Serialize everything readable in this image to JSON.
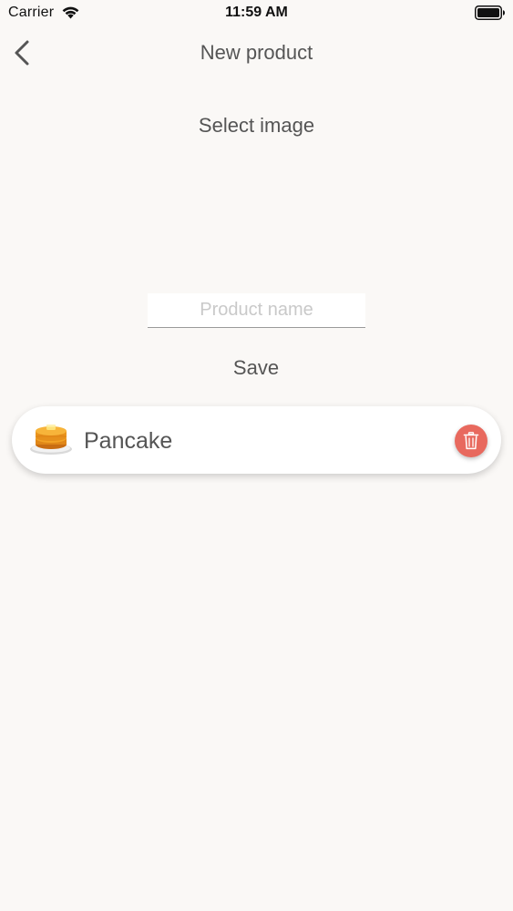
{
  "status_bar": {
    "carrier": "Carrier",
    "time": "11:59 AM",
    "wifi_icon": "wifi-icon",
    "battery_icon": "battery-icon"
  },
  "nav": {
    "back_icon": "chevron-left-icon",
    "title": "New product"
  },
  "form": {
    "select_image_label": "Select image",
    "product_name_placeholder": "Product name",
    "product_name_value": "",
    "save_label": "Save"
  },
  "products": [
    {
      "name": "Pancake",
      "icon": "pancake-icon",
      "delete_icon": "trash-icon"
    }
  ],
  "colors": {
    "background": "#faf8f6",
    "text": "#555555",
    "delete_accent": "#e8695e",
    "card": "#ffffff"
  }
}
